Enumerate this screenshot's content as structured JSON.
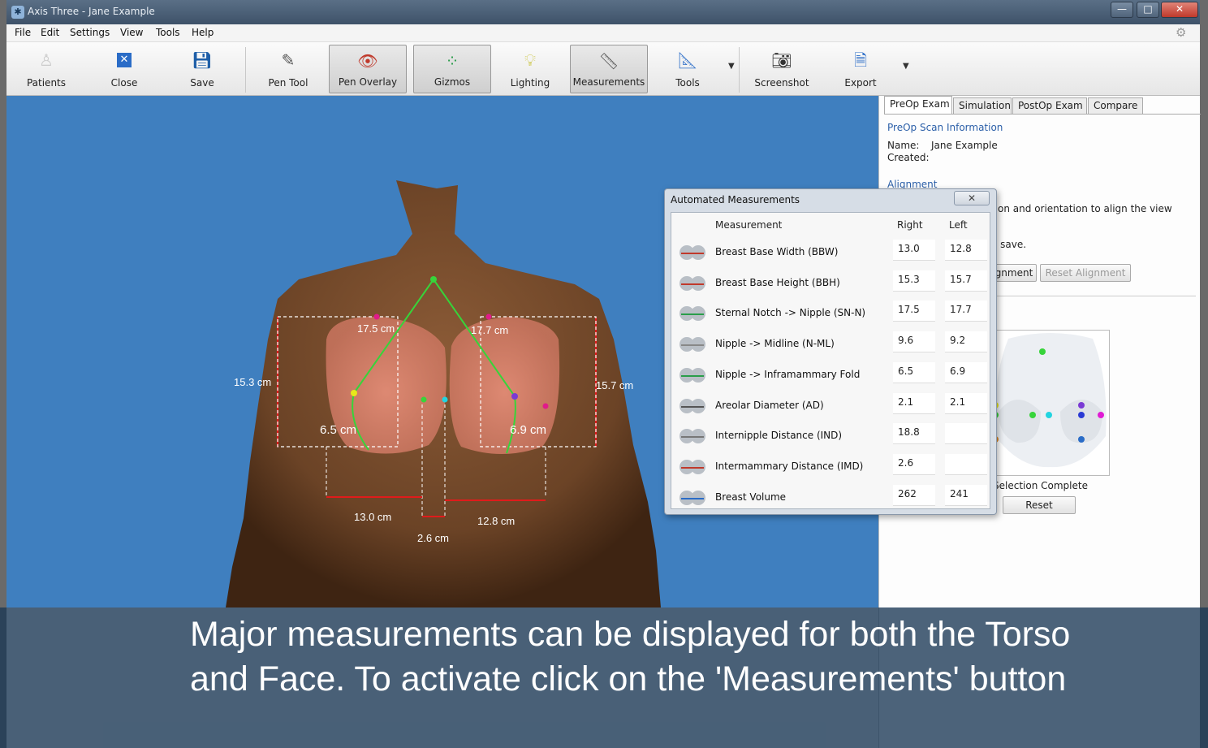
{
  "window": {
    "title": "Axis Three - Jane Example",
    "minimize": "—",
    "maximize": "□",
    "close": "✕"
  },
  "menu": [
    "File",
    "Edit",
    "Settings",
    "View",
    "Tools",
    "Help"
  ],
  "toolbar": {
    "patients": "Patients",
    "close": "Close",
    "save": "Save",
    "pen_tool": "Pen Tool",
    "pen_overlay": "Pen Overlay",
    "gizmos": "Gizmos",
    "lighting": "Lighting",
    "measurements": "Measurements",
    "tools": "Tools",
    "screenshot": "Screenshot",
    "export": "Export"
  },
  "viewport": {
    "labels": {
      "sn_right": "17.5 cm",
      "sn_left": "17.7 cm",
      "bbh_right": "15.3 cm",
      "bbh_left": "15.7 cm",
      "nif_right": "6.5 cm",
      "nif_left": "6.9 cm",
      "bbw_right": "13.0 cm",
      "bbw_left": "12.8 cm",
      "imd": "2.6 cm"
    }
  },
  "right_panel": {
    "tabs": [
      "PreOp Exam",
      "Simulation",
      "PostOp Exam",
      "Compare"
    ],
    "section_title": "PreOp Scan Information",
    "name_label": "Name:",
    "name_value": "Jane Example",
    "created_label": "Created:",
    "alignment_title": "Alignment",
    "alignment_text": "tion and orientation to align the view",
    "save_text": "o save.",
    "alignment_button": "gnment",
    "reset_alignment": "Reset Alignment",
    "selection_status": "Selection Complete",
    "reset": "Reset"
  },
  "dialog": {
    "title": "Automated Measurements",
    "close": "✕",
    "headers": {
      "measurement": "Measurement",
      "right": "Right",
      "left": "Left"
    },
    "rows": [
      {
        "name": "Breast Base Width (BBW)",
        "right": "13.0",
        "left": "12.8"
      },
      {
        "name": "Breast Base Height (BBH)",
        "right": "15.3",
        "left": "15.7"
      },
      {
        "name": "Sternal Notch -> Nipple (SN-N)",
        "right": "17.5",
        "left": "17.7"
      },
      {
        "name": "Nipple -> Midline (N-ML)",
        "right": "9.6",
        "left": "9.2"
      },
      {
        "name": "Nipple -> Inframammary Fold",
        "right": "6.5",
        "left": "6.9"
      },
      {
        "name": "Areolar Diameter (AD)",
        "right": "2.1",
        "left": "2.1"
      },
      {
        "name": "Internipple Distance (IND)",
        "right": "18.8",
        "left": ""
      },
      {
        "name": "Intermammary Distance (IMD)",
        "right": "2.6",
        "left": ""
      },
      {
        "name": "Breast Volume",
        "right": "262",
        "left": "241"
      }
    ]
  },
  "caption": "Major measurements can be displayed for both the Torso and Face. To activate click on the 'Measurements' button",
  "colors": {
    "viewport_bg": "#3f7fbf",
    "caption_bg": "#193755",
    "link": "#2b5fa8"
  }
}
